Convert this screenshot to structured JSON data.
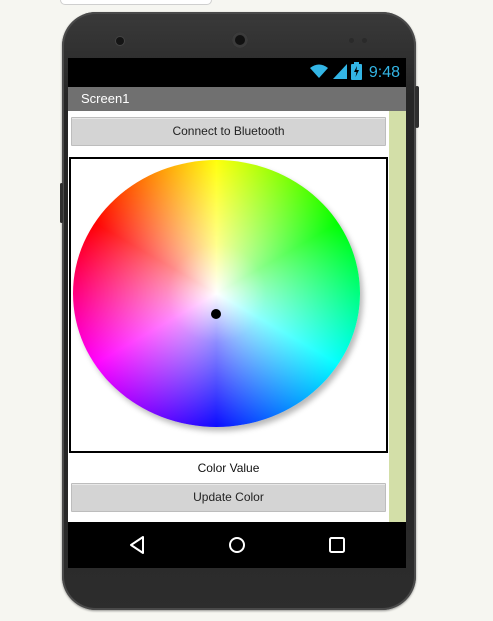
{
  "status_bar": {
    "time": "9:48",
    "icons": [
      "wifi-icon",
      "signal-icon",
      "battery-charging-icon"
    ],
    "icon_color": "#33b5e5"
  },
  "screen": {
    "title": "Screen1"
  },
  "buttons": {
    "connect_label": "Connect to Bluetooth",
    "update_label": "Update Color"
  },
  "color_value_label": "Color Value",
  "navigation": [
    "back-icon",
    "home-icon",
    "recents-icon"
  ],
  "colors": {
    "title_bar": "#707070",
    "button_bg": "#d4d4d4",
    "scroll_track": "#d3dfa8",
    "phone_body": "#262626"
  }
}
